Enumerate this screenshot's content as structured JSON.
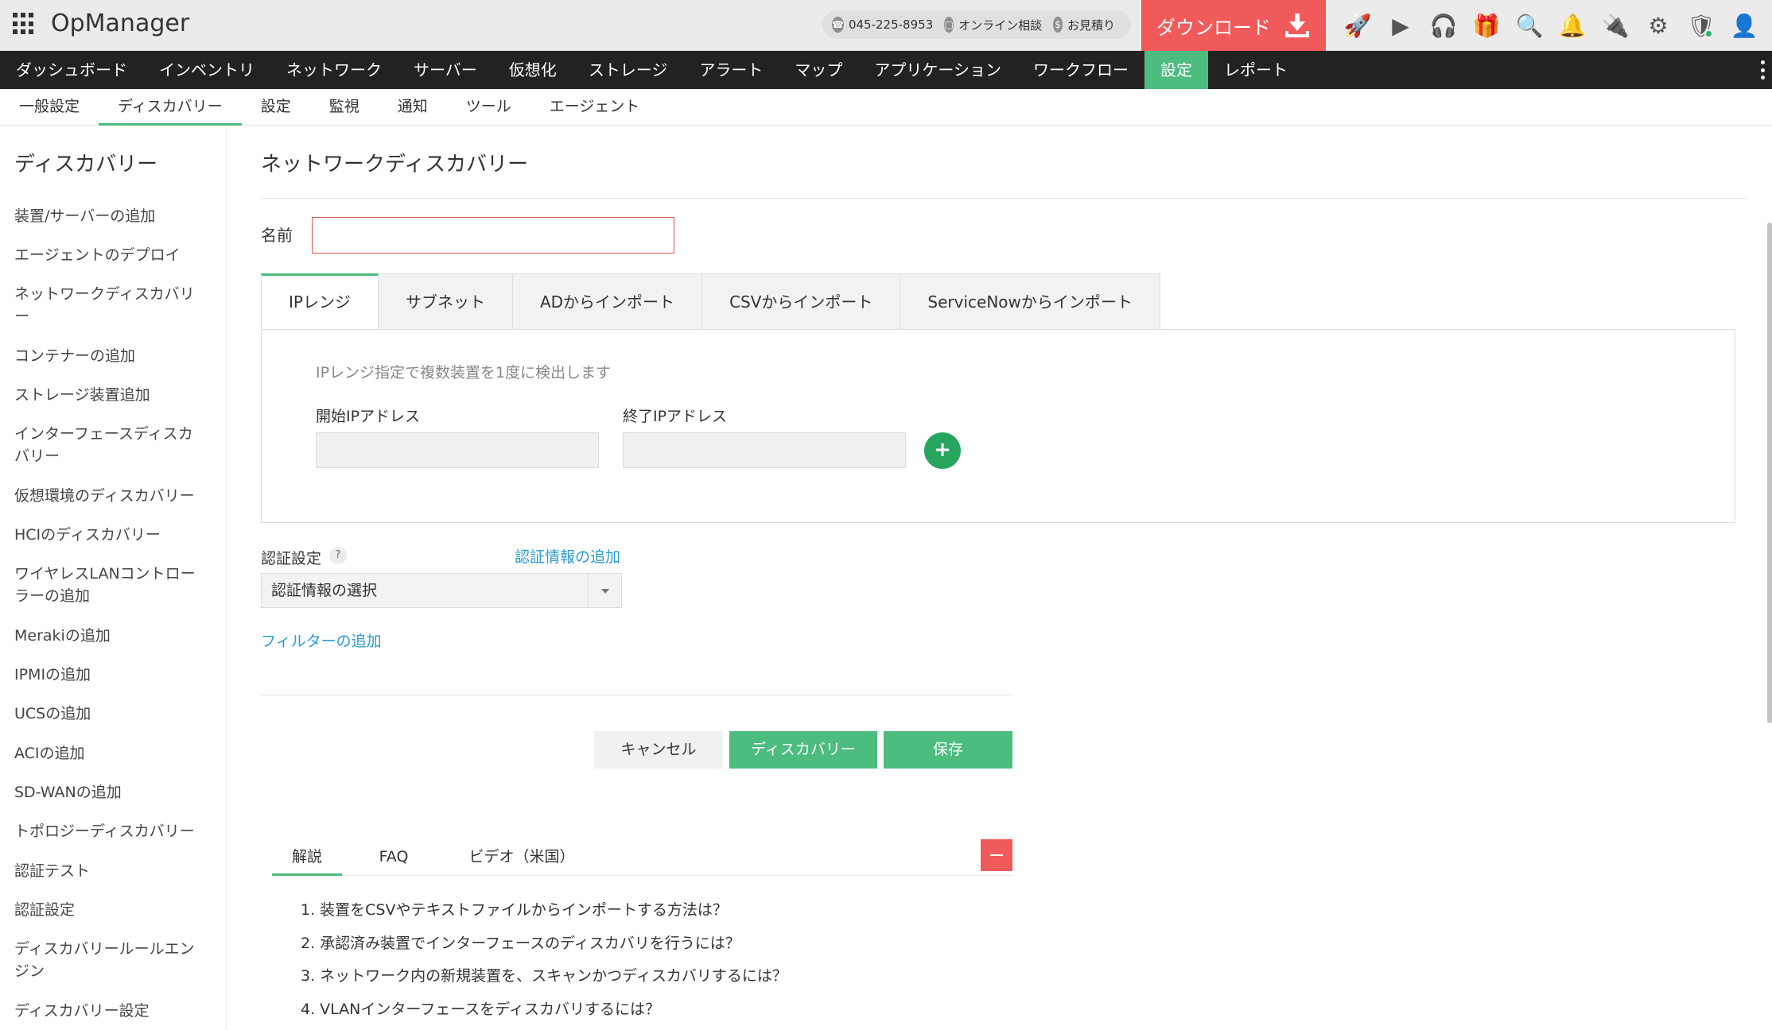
{
  "header": {
    "brand": "OpManager",
    "phone": "045-225-8953",
    "online_consult": "オンライン相談",
    "quote": "お見積り",
    "download": "ダウンロード"
  },
  "main_nav": {
    "dashboard": "ダッシュボード",
    "inventory": "インベントリ",
    "network": "ネットワーク",
    "server": "サーバー",
    "virtualization": "仮想化",
    "storage": "ストレージ",
    "alert": "アラート",
    "map": "マップ",
    "application": "アプリケーション",
    "workflow": "ワークフロー",
    "settings": "設定",
    "report": "レポート"
  },
  "sub_nav": {
    "general": "一般設定",
    "discovery": "ディスカバリー",
    "config": "設定",
    "monitoring": "監視",
    "notification": "通知",
    "tools": "ツール",
    "agent": "エージェント"
  },
  "sidebar": {
    "title": "ディスカバリー",
    "items": [
      "装置/サーバーの追加",
      "エージェントのデプロイ",
      "ネットワークディスカバリー",
      "コンテナーの追加",
      "ストレージ装置追加",
      "インターフェースディスカバリー",
      "仮想環境のディスカバリー",
      "HCIのディスカバリー",
      "ワイヤレスLANコントローラーの追加",
      "Merakiの追加",
      "IPMIの追加",
      "UCSの追加",
      "ACIの追加",
      "SD-WANの追加",
      "トポロジーディスカバリー",
      "認証テスト",
      "認証設定",
      "ディスカバリールールエンジン",
      "ディスカバリー設定"
    ]
  },
  "page": {
    "title": "ネットワークディスカバリー",
    "name_label": "名前",
    "name_value": ""
  },
  "tabs": {
    "ip_range": "IPレンジ",
    "subnet": "サブネット",
    "ad_import": "ADからインポート",
    "csv_import": "CSVからインポート",
    "servicenow_import": "ServiceNowからインポート"
  },
  "ip_range_panel": {
    "hint": "IPレンジ指定で複数装置を1度に検出します",
    "start_label": "開始IPアドレス",
    "end_label": "終了IPアドレス",
    "start_value": "",
    "end_value": "",
    "add_symbol": "+"
  },
  "auth": {
    "label": "認証設定",
    "help": "?",
    "add_link": "認証情報の追加",
    "select_value": "認証情報の選択"
  },
  "filter_link": "フィルターの追加",
  "buttons": {
    "cancel": "キャンセル",
    "discover": "ディスカバリー",
    "save": "保存"
  },
  "help_tabs": {
    "explanation": "解説",
    "faq": "FAQ",
    "video": "ビデオ（米国）"
  },
  "faq_items": [
    "1. 装置をCSVやテキストファイルからインポートする方法は？",
    "2. 承認済み装置でインターフェースのディスカバリを行うには？",
    "3. ネットワーク内の新規装置を、スキャンかつディスカバリするには？",
    "4. VLANインターフェースをディスカバリするには？"
  ],
  "colors": {
    "accent_green": "#4cbc7f",
    "download_red": "#f15a5a",
    "link_blue": "#2b9bd1",
    "nav_dark": "#222222"
  }
}
